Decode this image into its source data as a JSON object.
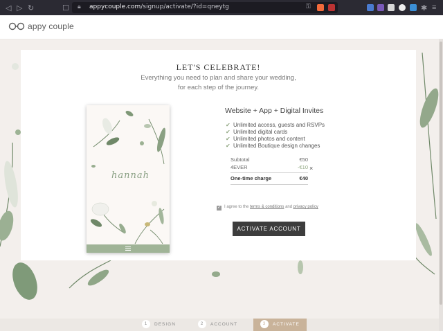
{
  "browser": {
    "url_host": "appycouple.com",
    "url_path": "/signup/activate/?id=qneytg"
  },
  "site": {
    "logo_text": "appy couple"
  },
  "card": {
    "title": "LET'S CELEBRATE!",
    "subtitle_line1": "Everything you need to plan and share your wedding,",
    "subtitle_line2": "for each step of the journey."
  },
  "preview": {
    "name": "hannah"
  },
  "plan": {
    "title": "Website + App + Digital Invites",
    "features": [
      "Unlimited access, guests and RSVPs",
      "Unlimited digital cards",
      "Unlimited photos and content",
      "Unlimited Boutique design changes"
    ]
  },
  "totals": {
    "subtotal_label": "Subtotal",
    "subtotal_value": "€50",
    "code_label": "4EVER",
    "code_value": "-€10",
    "remove_symbol": "×",
    "total_label": "One-time charge",
    "total_value": "€40"
  },
  "agree": {
    "prefix": "I agree to the",
    "terms": "terms & conditions",
    "and": "and",
    "privacy": "privacy policy"
  },
  "activate_button": "ACTIVATE ACCOUNT",
  "steps": [
    {
      "num": "1",
      "label": "DESIGN"
    },
    {
      "num": "2",
      "label": "ACCOUNT"
    },
    {
      "num": "3",
      "label": "ACTIVATE"
    }
  ],
  "colors": {
    "accent_green": "#8ea57f",
    "step_active": "#c9b39a",
    "button_dark": "#3d3d3d"
  },
  "icons": [
    "back-icon",
    "forward-icon",
    "reload-icon",
    "bookmark-icon",
    "lock-icon",
    "key-icon",
    "brave-shield-icon",
    "checkmark-icon",
    "remove-icon",
    "menu-icon",
    "logo-icon"
  ]
}
